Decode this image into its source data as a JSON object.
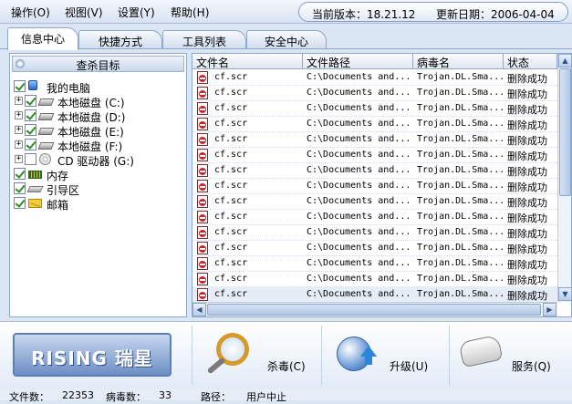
{
  "menu": {
    "items": [
      "操作(O)",
      "视图(V)",
      "设置(Y)",
      "帮助(H)"
    ]
  },
  "version": {
    "current_label": "当前版本：18.21.12",
    "update_label": "更新日期：2006-04-04"
  },
  "tabs": [
    {
      "label": "信息中心",
      "active": true
    },
    {
      "label": "快捷方式",
      "active": false
    },
    {
      "label": "工具列表",
      "active": false
    },
    {
      "label": "安全中心",
      "active": false
    }
  ],
  "scan_target": {
    "header": "查杀目标",
    "tree": [
      {
        "label": "我的电脑",
        "checked": true,
        "icon": "computer-icon",
        "expandable": false,
        "level": 0
      },
      {
        "label": "本地磁盘 (C:)",
        "checked": true,
        "icon": "drive-icon",
        "expandable": true,
        "level": 1
      },
      {
        "label": "本地磁盘 (D:)",
        "checked": true,
        "icon": "drive-icon",
        "expandable": true,
        "level": 1
      },
      {
        "label": "本地磁盘 (E:)",
        "checked": true,
        "icon": "drive-icon",
        "expandable": true,
        "level": 1
      },
      {
        "label": "本地磁盘 (F:)",
        "checked": true,
        "icon": "drive-icon",
        "expandable": true,
        "level": 1
      },
      {
        "label": "CD 驱动器 (G:)",
        "checked": false,
        "icon": "cd-drive-icon",
        "expandable": true,
        "level": 1
      },
      {
        "label": "内存",
        "checked": true,
        "icon": "memory-icon",
        "expandable": false,
        "level": 0
      },
      {
        "label": "引导区",
        "checked": true,
        "icon": "boot-sector-icon",
        "expandable": false,
        "level": 0
      },
      {
        "label": "邮箱",
        "checked": true,
        "icon": "mail-icon",
        "expandable": false,
        "level": 0
      }
    ]
  },
  "results": {
    "columns": [
      "文件名",
      "文件路径",
      "病毒名",
      "状态"
    ],
    "rows": [
      [
        "cf.scr",
        "C:\\Documents and...",
        "Trojan.DL.Sma...",
        "删除成功"
      ],
      [
        "cf.scr",
        "C:\\Documents and...",
        "Trojan.DL.Sma...",
        "删除成功"
      ],
      [
        "cf.scr",
        "C:\\Documents and...",
        "Trojan.DL.Sma...",
        "删除成功"
      ],
      [
        "cf.scr",
        "C:\\Documents and...",
        "Trojan.DL.Sma...",
        "删除成功"
      ],
      [
        "cf.scr",
        "C:\\Documents and...",
        "Trojan.DL.Sma...",
        "删除成功"
      ],
      [
        "cf.scr",
        "C:\\Documents and...",
        "Trojan.DL.Sma...",
        "删除成功"
      ],
      [
        "cf.scr",
        "C:\\Documents and...",
        "Trojan.DL.Sma...",
        "删除成功"
      ],
      [
        "cf.scr",
        "C:\\Documents and...",
        "Trojan.DL.Sma...",
        "删除成功"
      ],
      [
        "cf.scr",
        "C:\\Documents and...",
        "Trojan.DL.Sma...",
        "删除成功"
      ],
      [
        "cf.scr",
        "C:\\Documents and...",
        "Trojan.DL.Sma...",
        "删除成功"
      ],
      [
        "cf.scr",
        "C:\\Documents and...",
        "Trojan.DL.Sma...",
        "删除成功"
      ],
      [
        "cf.scr",
        "C:\\Documents and...",
        "Trojan.DL.Sma...",
        "删除成功"
      ],
      [
        "cf.scr",
        "C:\\Documents and...",
        "Trojan.DL.Sma...",
        "删除成功"
      ],
      [
        "cf.scr",
        "C:\\Documents and...",
        "Trojan.DL.Sma...",
        "删除成功"
      ],
      [
        "cf.scr",
        "C:\\Documents and...",
        "Trojan.DL.Sma...",
        "删除成功"
      ]
    ],
    "selected_row": 14
  },
  "actions": {
    "logo": "RISING 瑞星",
    "scan_label": "杀毒(C)",
    "upgrade_label": "升级(U)",
    "service_label": "服务(Q)"
  },
  "status": {
    "files_label": "文件数：",
    "files_value": "22353",
    "virus_label": "病毒数：",
    "virus_value": "33",
    "path_label": "路径：",
    "path_value": "用户中止"
  },
  "colors": {
    "frame_bg": "#dbe6f4",
    "border": "#8ea7cc",
    "accent_green": "#2a8d2a",
    "alert_red": "#c7262b"
  }
}
